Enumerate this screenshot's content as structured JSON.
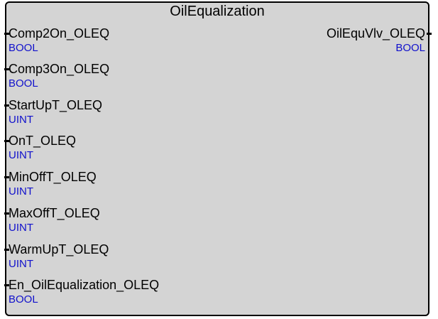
{
  "block": {
    "title": "OilEqualization",
    "type_color": "#1010cc",
    "inputs": [
      {
        "name": "Comp2On_OLEQ",
        "type": "BOOL"
      },
      {
        "name": "Comp3On_OLEQ",
        "type": "BOOL"
      },
      {
        "name": "StartUpT_OLEQ",
        "type": "UINT"
      },
      {
        "name": "OnT_OLEQ",
        "type": "UINT"
      },
      {
        "name": "MinOffT_OLEQ",
        "type": "UINT"
      },
      {
        "name": "MaxOffT_OLEQ",
        "type": "UINT"
      },
      {
        "name": "WarmUpT_OLEQ",
        "type": "UINT"
      },
      {
        "name": "En_OilEqualization_OLEQ",
        "type": "BOOL"
      }
    ],
    "outputs": [
      {
        "name": "OilEquVlv_OLEQ",
        "type": "BOOL"
      }
    ]
  }
}
